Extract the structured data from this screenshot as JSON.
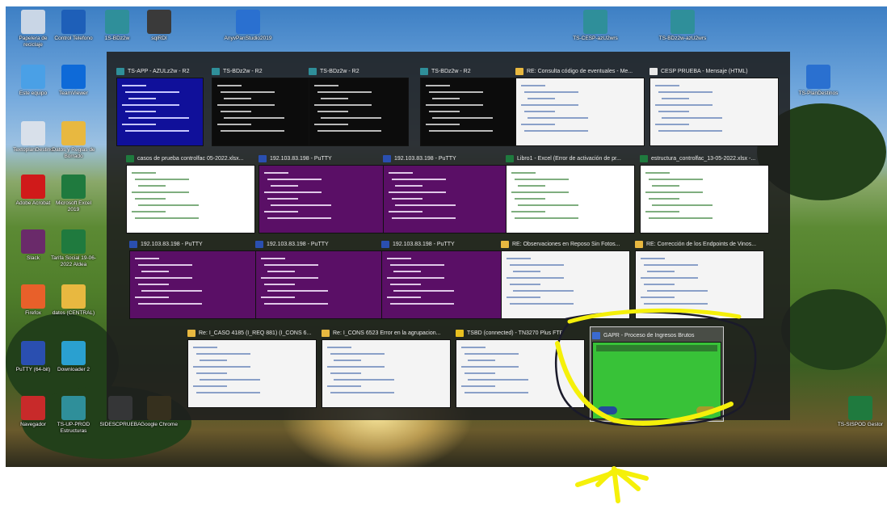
{
  "desktop_icons": [
    {
      "label": "Papelera de reciclaje",
      "icon": "recycle-bin-icon",
      "color": "#c9d6e6"
    },
    {
      "label": "Control Telefono",
      "icon": "control-panel-icon",
      "color": "#1e5fb8"
    },
    {
      "label": "1S-BDz2w",
      "icon": "rdp-icon",
      "color": "#2f8f9a"
    },
    {
      "label": "sqlRDI",
      "icon": "tool-icon",
      "color": "#3a3a3a"
    },
    {
      "label": "AnyvPanStudio2019",
      "icon": "installer-icon",
      "color": "#2a70d0"
    },
    {
      "label": "TS-CESP-azU2wrs",
      "icon": "rdp-icon",
      "color": "#2f8f9a"
    },
    {
      "label": "TS-BDz2w-azU2wrs",
      "icon": "rdp-icon",
      "color": "#2f8f9a"
    },
    {
      "label": "Este equipo",
      "icon": "computer-icon",
      "color": "#4aa0e6"
    },
    {
      "label": "TeamViewer",
      "icon": "teamviewer-icon",
      "color": "#0e6ad8"
    },
    {
      "label": "TS-PlanDestinos",
      "icon": "installer-icon",
      "color": "#2a70d0"
    },
    {
      "label": "TextoplanDestino",
      "icon": "file-icon",
      "color": "#d8e0ea"
    },
    {
      "label": "Datos y Reglas de Borrado",
      "icon": "folder-icon",
      "color": "#e8b840"
    },
    {
      "label": "Adobe Acrobat",
      "icon": "pdf-icon",
      "color": "#d01a1a"
    },
    {
      "label": "Microsoft Excel 2019",
      "icon": "excel-icon",
      "color": "#1f7a3e"
    },
    {
      "label": "Slack",
      "icon": "slack-icon",
      "color": "#6a2a6a"
    },
    {
      "label": "Tarifa Social 19-06-2022 Aldea",
      "icon": "excel-file-icon",
      "color": "#1f7a3e"
    },
    {
      "label": "Firefox",
      "icon": "firefox-icon",
      "color": "#e8602a"
    },
    {
      "label": "datos (CENTRAL)",
      "icon": "folder-icon",
      "color": "#e8b840"
    },
    {
      "label": "PuTTY (64-bit)",
      "icon": "putty-icon",
      "color": "#2a4fb0"
    },
    {
      "label": "Downloader 2",
      "icon": "downloader-icon",
      "color": "#2aa0d0"
    },
    {
      "label": "Navegador",
      "icon": "browser-icon",
      "color": "#c82a2a"
    },
    {
      "label": "TS-UP-PROD Estructuras",
      "icon": "rdp-icon",
      "color": "#2f8f9a"
    },
    {
      "label": "SIDESCPRUEBA",
      "icon": "file-icon",
      "color": "#d8e0ea"
    },
    {
      "label": "Google Chrome",
      "icon": "chrome-icon",
      "color": "#e0b020"
    },
    {
      "label": "TS-SISPOD Gestor",
      "icon": "excel-file-icon",
      "color": "#1f7a3e"
    }
  ],
  "windows": [
    {
      "title": "TS-APP - AZULz2w - R2",
      "icon": "rdp-icon",
      "color": "#2f8f9a",
      "preview": "blue"
    },
    {
      "title": "TS-BDz2w - R2",
      "icon": "rdp-icon",
      "color": "#2f8f9a",
      "preview": "black"
    },
    {
      "title": "TS-BDz2w - R2",
      "icon": "rdp-icon",
      "color": "#2f8f9a",
      "preview": "black"
    },
    {
      "title": "TS-BDz2w - R2",
      "icon": "rdp-icon",
      "color": "#2f8f9a",
      "preview": "black"
    },
    {
      "title": "RE: Consulta código de eventuales - Me...",
      "icon": "mail-icon",
      "color": "#e8b840",
      "preview": "white"
    },
    {
      "title": "CESP PRUEBA - Mensaje (HTML)",
      "icon": "mail-icon",
      "color": "#e8e8e8",
      "preview": "white"
    },
    {
      "title": "casos de prueba controlfac 05-2022.xlsx...",
      "icon": "excel-icon",
      "color": "#1f7a3e",
      "preview": "sheet"
    },
    {
      "title": "192.103.83.198 - PuTTY",
      "icon": "putty-icon",
      "color": "#2a4fb0",
      "preview": "purple"
    },
    {
      "title": "192.103.83.198 - PuTTY",
      "icon": "putty-icon",
      "color": "#2a4fb0",
      "preview": "purple"
    },
    {
      "title": "Libro1 - Excel (Error de activación de pr...",
      "icon": "excel-icon",
      "color": "#1f7a3e",
      "preview": "sheet"
    },
    {
      "title": "estructura_controlfac_13-05-2022.xlsx -...",
      "icon": "excel-icon",
      "color": "#1f7a3e",
      "preview": "sheet"
    },
    {
      "title": "192.103.83.198 - PuTTY",
      "icon": "putty-icon",
      "color": "#2a4fb0",
      "preview": "purple"
    },
    {
      "title": "192.103.83.198 - PuTTY",
      "icon": "putty-icon",
      "color": "#2a4fb0",
      "preview": "purple"
    },
    {
      "title": "192.103.83.198 - PuTTY",
      "icon": "putty-icon",
      "color": "#2a4fb0",
      "preview": "purple"
    },
    {
      "title": "RE: Observaciones en Reposo Sin Fotos...",
      "icon": "mail-icon",
      "color": "#e8b840",
      "preview": "white"
    },
    {
      "title": "RE: Corrección de los Endpoints de Vinos...",
      "icon": "mail-icon",
      "color": "#e8b840",
      "preview": "white"
    },
    {
      "title": "Re: I_CASO 4185 (I_REQ 881) (I_CONS 6...",
      "icon": "mail-icon",
      "color": "#e8b840",
      "preview": "white"
    },
    {
      "title": "Re: I_CONS 6523 Error en la agrupacion...",
      "icon": "mail-icon",
      "color": "#e8b840",
      "preview": "white"
    },
    {
      "title": "TSBD (connected) - TN3270 Plus FTP",
      "icon": "ftp-icon",
      "color": "#e8c020",
      "preview": "white"
    },
    {
      "title": "GAPR - Proceso de Ingresos Brutos",
      "icon": "app-icon",
      "color": "#3a6ad0",
      "preview": "gapr"
    }
  ],
  "annotation_color": "#f5f00a",
  "annotation_circle_color": "#1a1a2a"
}
